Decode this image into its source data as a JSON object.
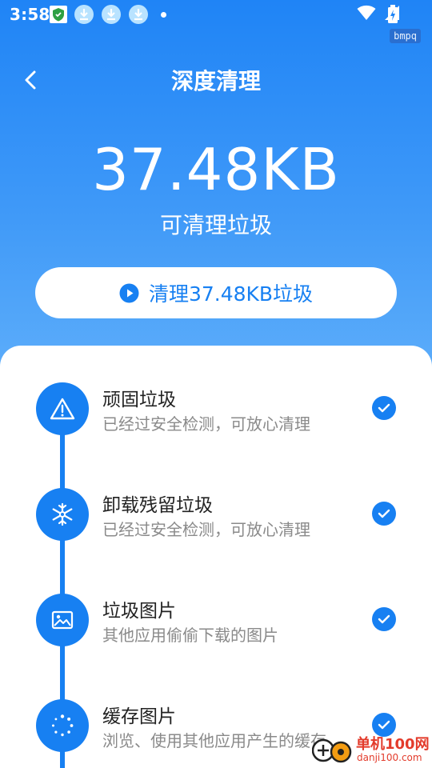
{
  "status_bar": {
    "time": "3:58",
    "icons": [
      "shield-notification-icon",
      "download-icon",
      "download-icon",
      "download-icon",
      "dot-icon",
      "wifi-icon",
      "cell-signal-icon",
      "battery-charging-icon"
    ],
    "tag": "bmpq"
  },
  "header": {
    "back_icon": "chevron-left-icon",
    "title": "深度清理"
  },
  "summary": {
    "size": "37.48KB",
    "subtitle": "可清理垃圾"
  },
  "action": {
    "icon": "play-circle-icon",
    "label": "清理37.48KB垃圾"
  },
  "items": [
    {
      "icon": "warning-triangle-icon",
      "title": "顽固垃圾",
      "desc": "已经过安全检测，可放心清理",
      "checked": true
    },
    {
      "icon": "snowflake-icon",
      "title": "卸载残留垃圾",
      "desc": "已经过安全检测，可放心清理",
      "checked": true
    },
    {
      "icon": "image-icon",
      "title": "垃圾图片",
      "desc": "其他应用偷偷下载的图片",
      "checked": true
    },
    {
      "icon": "loading-spinner-icon",
      "title": "缓存图片",
      "desc": "浏览、使用其他应用产生的缓存",
      "checked": true
    }
  ],
  "watermark": {
    "name": "单机100网",
    "url": "danji100.com"
  },
  "colors": {
    "primary": "#1780f2",
    "hero_top": "#1f84f6",
    "hero_bottom": "#5eaefa",
    "text_dark": "#222222",
    "text_gray": "#8a8a8a"
  }
}
